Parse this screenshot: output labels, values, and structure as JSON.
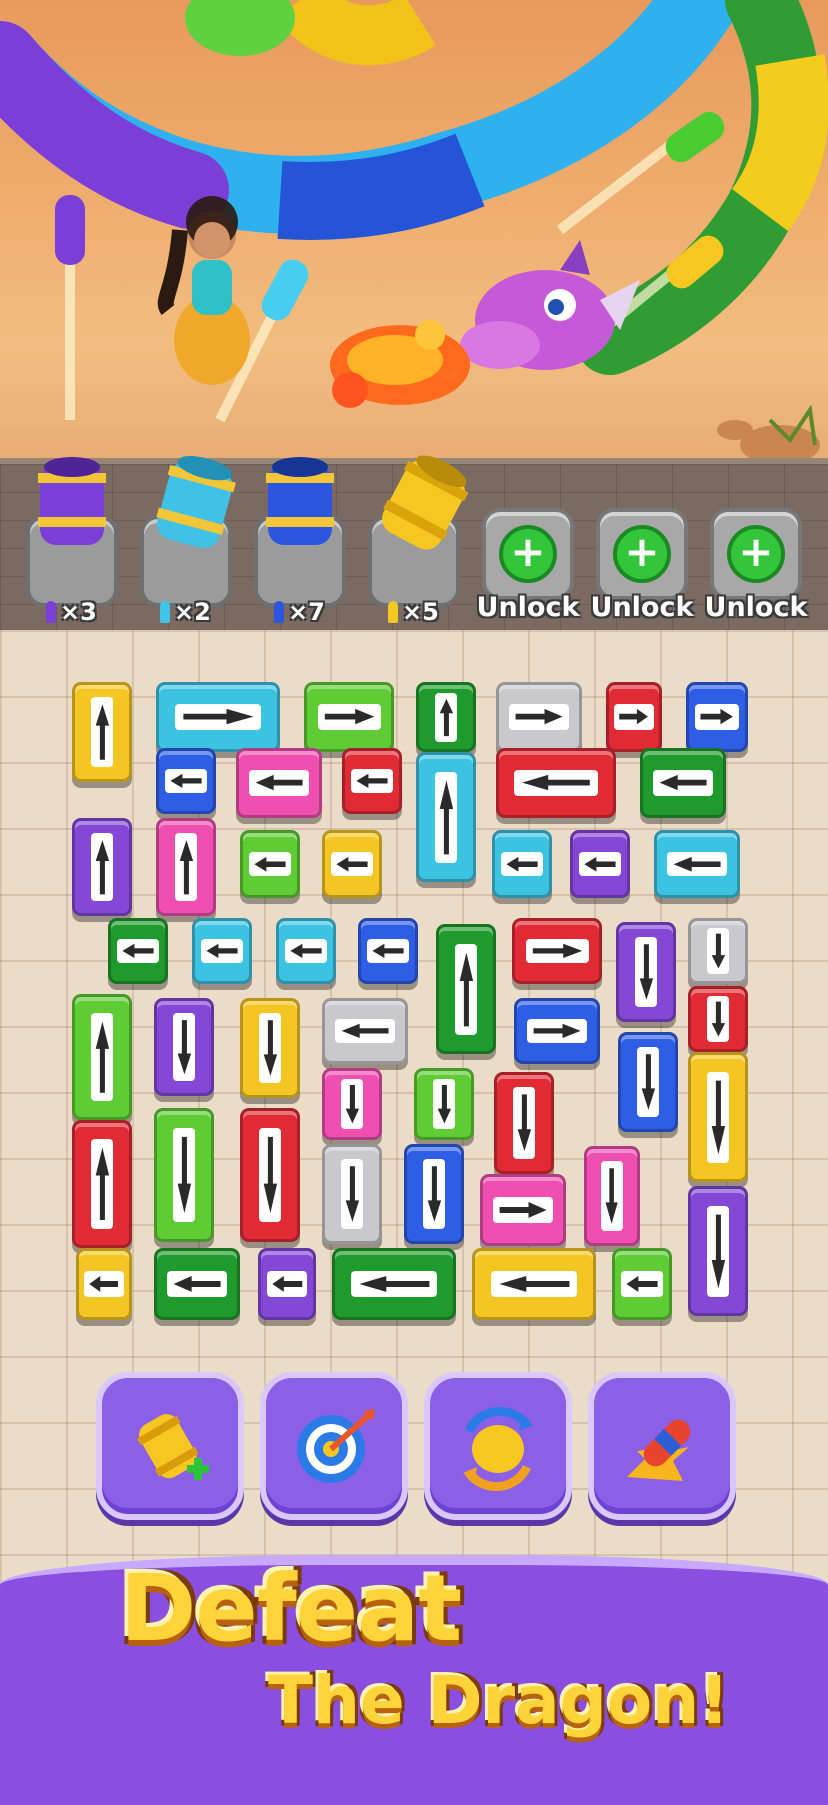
{
  "ammo": [
    {
      "label": "×3",
      "color": "#7a3fd6"
    },
    {
      "label": "×2",
      "color": "#3dc6e8"
    },
    {
      "label": "×7",
      "color": "#2c56e0"
    },
    {
      "label": "×5",
      "color": "#f5c720"
    }
  ],
  "unlock_slots": [
    {
      "label": "Unlock"
    },
    {
      "label": "Unlock"
    },
    {
      "label": "Unlock"
    }
  ],
  "boosters": [
    {
      "name": "add-cannon-booster",
      "icon": "cannon-plus-icon"
    },
    {
      "name": "target-booster",
      "icon": "target-icon"
    },
    {
      "name": "shuffle-booster",
      "icon": "shuffle-icon"
    },
    {
      "name": "rocket-booster",
      "icon": "rocket-icon"
    }
  ],
  "banner": {
    "line1": "Defeat",
    "line2": "The Dragon!"
  },
  "colors": {
    "yellow": "#f4c623",
    "cyan": "#3cc3e2",
    "green": "#5fcc35",
    "dgreen": "#1f9a2c",
    "gray": "#c9c9cc",
    "red": "#e02b35",
    "blue": "#2f5ee6",
    "pink": "#ef4fb0",
    "purple": "#8447d6"
  }
}
